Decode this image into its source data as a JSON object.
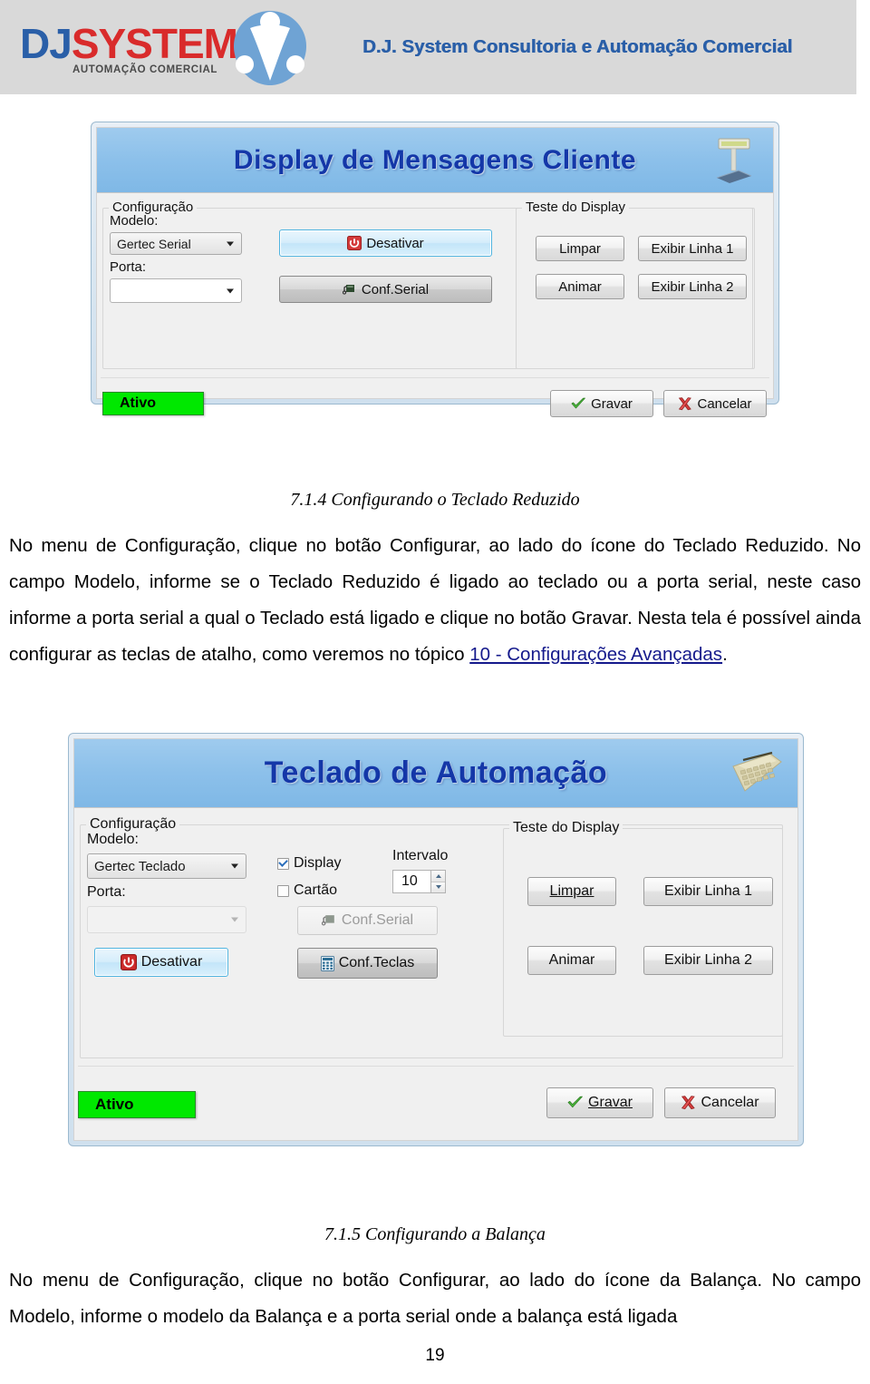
{
  "header": {
    "logo_dj": "DJ",
    "logo_system": "SYSTEM",
    "logo_tagline": "AUTOMAÇÃO COMERCIAL",
    "company_title": "D.J. System Consultoria e Automação Comercial",
    "brand_blue": "#2a5fa8",
    "brand_red": "#d92b2b",
    "banner_bg": "#d9d9d9"
  },
  "dialog_display": {
    "title": "Display de Mensagens Cliente",
    "banner_icon": "customer-display-pole-icon",
    "group_legend": "Configuração",
    "model_label": "Modelo:",
    "model_value": "Gertec Serial",
    "port_label": "Porta:",
    "port_value": "",
    "deactivate_button": "Desativar",
    "serial_config_button": "Conf.Serial",
    "test_group_legend": "Teste do Display",
    "clear_button": "Limpar",
    "animate_button": "Animar",
    "show_line1_button": "Exibir Linha 1",
    "show_line2_button": "Exibir Linha 2",
    "status_label": "Ativo",
    "save_button": "Gravar",
    "cancel_button": "Cancelar",
    "status_color": "#00e800",
    "title_color": "#1437a8",
    "banner_color": "#8cc0ea"
  },
  "section_1": {
    "heading": "7.1.4  Configurando o Teclado Reduzido",
    "paragraph_part1": "No menu de Configuração, clique no botão Configurar, ao lado do ícone do Teclado Reduzido. No campo Modelo, informe se o Teclado Reduzido é ligado ao teclado ou a porta serial, neste caso informe a porta serial a qual o Teclado está ligado e clique no botão Gravar. Nesta tela é possível ainda configurar as teclas de atalho, como veremos no tópico ",
    "paragraph_link": "10 - Configurações  Avançadas",
    "paragraph_part2": "."
  },
  "dialog_keyboard": {
    "title": "Teclado de Automação",
    "banner_icon": "programmable-keyboard-icon",
    "group_legend": "Configuração",
    "model_label": "Modelo:",
    "model_value": "Gertec Teclado",
    "port_label": "Porta:",
    "port_value": "",
    "display_checkbox": "Display",
    "display_checked": true,
    "card_checkbox": "Cartão",
    "card_checked": false,
    "interval_label": "Intervalo",
    "interval_value": "10",
    "deactivate_button": "Desativar",
    "serial_config_button": "Conf.Serial",
    "keys_config_button": "Conf.Teclas",
    "test_group_legend": "Teste do Display",
    "clear_button": "Limpar",
    "animate_button": "Animar",
    "show_line1_button": "Exibir Linha 1",
    "show_line2_button": "Exibir Linha 2",
    "status_label": "Ativo",
    "save_button": "Gravar",
    "cancel_button": "Cancelar"
  },
  "section_2": {
    "heading": "7.1.5  Configurando a Balança",
    "paragraph": "No menu de Configuração, clique no botão Configurar, ao lado do ícone da Balança. No campo Modelo, informe  o modelo da Balança e a porta serial onde a balança está ligada"
  },
  "footer": {
    "page_number": "19"
  }
}
